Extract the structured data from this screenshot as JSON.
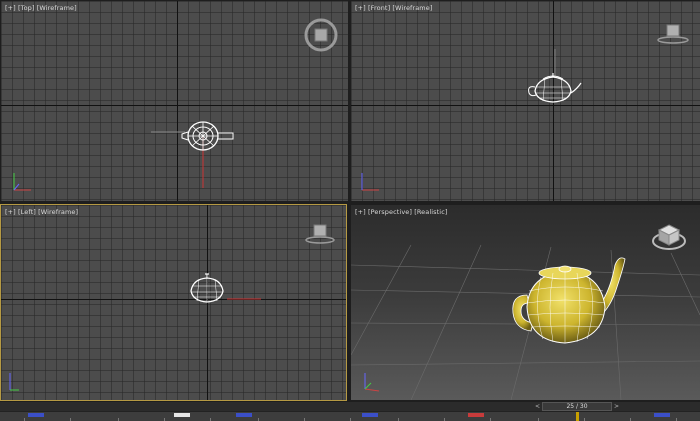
{
  "viewports": {
    "top": {
      "label_plus": "[+]",
      "label_view": "[Top]",
      "label_shading": "[Wireframe]"
    },
    "front": {
      "label_plus": "[+]",
      "label_view": "[Front]",
      "label_shading": "[Wireframe]"
    },
    "left": {
      "label_plus": "[+]",
      "label_view": "[Left]",
      "label_shading": "[Wireframe]"
    },
    "perspective": {
      "label_plus": "[+]",
      "label_view": "[Perspective]",
      "label_shading": "[Realistic]"
    }
  },
  "time_slider": {
    "value": "25 / 30",
    "prev": "<",
    "next": ">"
  },
  "colors": {
    "active_border": "#b69a43",
    "teapot_wire": "#ffffff",
    "teapot_shaded": "#d8c43a",
    "key_blue": "#3b4fc8",
    "key_red": "#c83b3b",
    "key_white": "#e6e6e6"
  }
}
